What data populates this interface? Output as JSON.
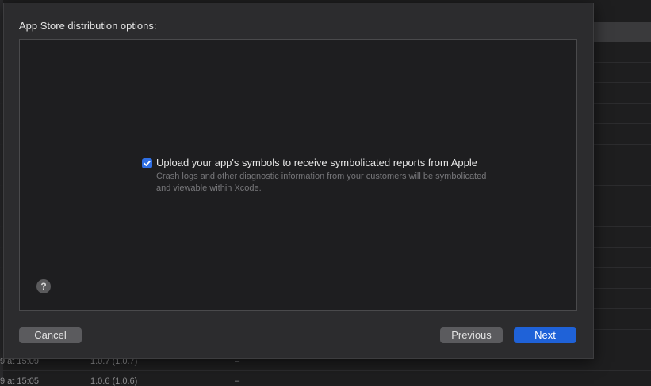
{
  "background": {
    "rows": [
      {
        "date": "9 at 15:09",
        "version": "1.0.7 (1.0.7)",
        "status": "–"
      },
      {
        "date": "9 at 15:05",
        "version": "1.0.6 (1.0.6)",
        "status": "–"
      }
    ]
  },
  "sheet": {
    "title": "App Store distribution options:",
    "option": {
      "checked": true,
      "label": "Upload your app's symbols to receive symbolicated reports from Apple",
      "description": "Crash logs and other diagnostic information from your customers will be symbolicated and viewable within Xcode."
    },
    "help_glyph": "?",
    "buttons": {
      "cancel": "Cancel",
      "previous": "Previous",
      "next": "Next"
    }
  },
  "colors": {
    "accent": "#1f62d8",
    "checkbox": "#2f6fe4"
  }
}
